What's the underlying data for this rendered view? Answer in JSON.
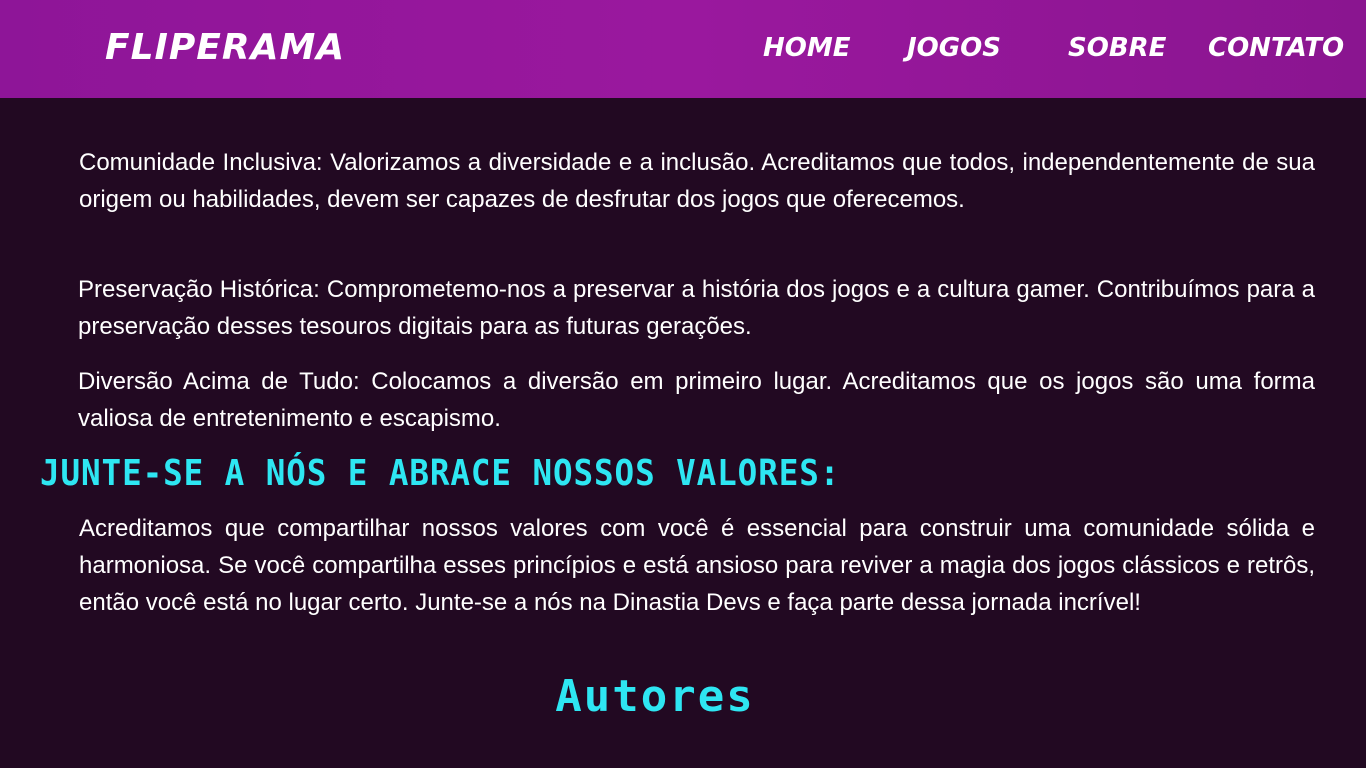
{
  "header": {
    "logo": "FLIPERAMA",
    "nav": {
      "home": "HOME",
      "jogos": "JOGOS",
      "sobre": "SOBRE",
      "contato": "CONTATO"
    }
  },
  "main": {
    "values": [
      "Comunidade Inclusiva: Valorizamos a diversidade e a inclusão. Acreditamos que todos, independentemente de sua origem ou habilidades, devem ser capazes de desfrutar dos jogos que oferecemos.",
      "Preservação Histórica: Comprometemo-nos a preservar a história dos jogos e a cultura gamer. Contribuímos para a preservação desses tesouros digitais para as futuras gerações.",
      "Diversão Acima de Tudo: Colocamos a diversão em primeiro lugar. Acreditamos que os jogos são uma forma valiosa de entretenimento e escapismo."
    ],
    "join_heading": "JUNTE-SE A NÓS E ABRACE NOSSOS VALORES:",
    "join_text": "Acreditamos que compartilhar nossos valores com você é essencial para construir uma comunidade sólida e harmoniosa. Se você compartilha esses princípios e está ansioso para reviver a magia dos jogos clássicos e retrôs, então você está no lugar certo. Junte-se a nós na Dinastia Devs e faça parte dessa jornada incrível!",
    "authors_heading": "Autores"
  },
  "colors": {
    "header_bg": "#9a189e",
    "page_bg": "#220922",
    "accent": "#2ee6f2",
    "text": "#ffffff"
  }
}
